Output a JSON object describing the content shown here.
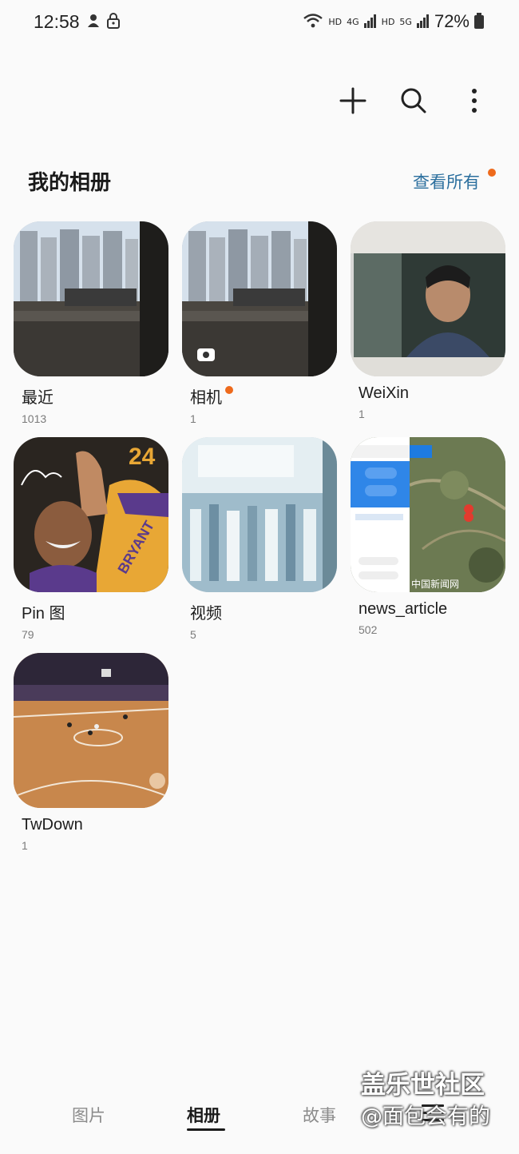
{
  "status_bar": {
    "time": "12:58",
    "network_labels": [
      "HD",
      "4G",
      "HD",
      "5G"
    ],
    "battery": "72%"
  },
  "toolbar": {
    "icons": [
      "plus-icon",
      "search-icon",
      "more-vert-icon"
    ]
  },
  "header": {
    "title": "我的相册",
    "view_all": "查看所有"
  },
  "albums": [
    {
      "name": "最近",
      "count": "1013"
    },
    {
      "name": "相机",
      "count": "1"
    },
    {
      "name": "WeiXin",
      "count": "1"
    },
    {
      "name": "Pin 图",
      "count": "79"
    },
    {
      "name": "视频",
      "count": "5"
    },
    {
      "name": "news_article",
      "count": "502"
    },
    {
      "name": "TwDown",
      "count": "1"
    }
  ],
  "thumb_text": {
    "jersey_number": "24",
    "jersey_name": "BRYANT",
    "map_watermark": "中国新闻网"
  },
  "bottom_nav": {
    "tabs": [
      "图片",
      "相册",
      "故事"
    ],
    "active": "相册"
  },
  "watermark": {
    "line1": "盖乐世社区",
    "line2": "@面包会有的"
  },
  "colors": {
    "accent_blue": "#2b6f9e",
    "new_dot": "#ee6a1c",
    "background": "#fafafa"
  }
}
